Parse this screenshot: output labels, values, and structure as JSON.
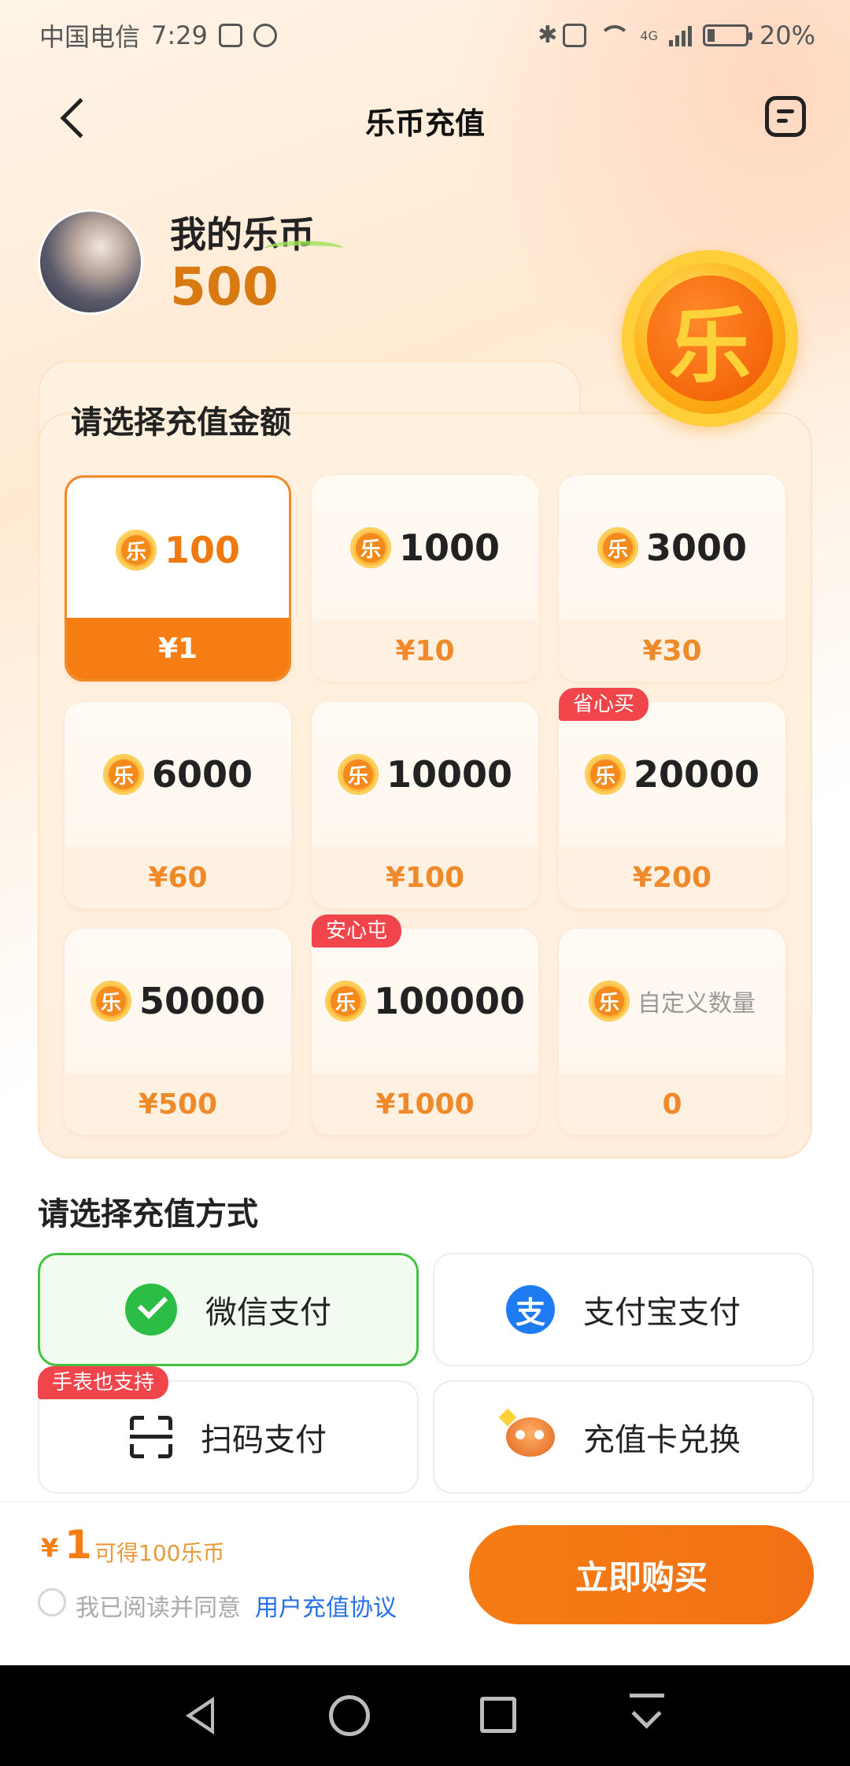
{
  "status_bar": {
    "carrier": "中国电信",
    "time": "7:29",
    "network": "4G",
    "battery": "20%",
    "battery_level": 0.2
  },
  "header": {
    "title": "乐币充值",
    "back_icon": "chevron-left-icon",
    "orders_icon": "order-list-icon"
  },
  "profile": {
    "label": "我的乐币",
    "balance": "500"
  },
  "amount_section": {
    "title": "请选择充值金额",
    "coin_glyph": "乐",
    "options": [
      {
        "coins": "100",
        "price": "¥1",
        "selected": true,
        "tag": ""
      },
      {
        "coins": "1000",
        "price": "¥10",
        "selected": false,
        "tag": ""
      },
      {
        "coins": "3000",
        "price": "¥30",
        "selected": false,
        "tag": ""
      },
      {
        "coins": "6000",
        "price": "¥60",
        "selected": false,
        "tag": ""
      },
      {
        "coins": "10000",
        "price": "¥100",
        "selected": false,
        "tag": ""
      },
      {
        "coins": "20000",
        "price": "¥200",
        "selected": false,
        "tag": "省心买"
      },
      {
        "coins": "50000",
        "price": "¥500",
        "selected": false,
        "tag": ""
      },
      {
        "coins": "100000",
        "price": "¥1000",
        "selected": false,
        "tag": "安心屯"
      },
      {
        "coins": "自定义数量",
        "price": "0",
        "selected": false,
        "tag": ""
      }
    ]
  },
  "payment_section": {
    "title": "请选择充值方式",
    "methods": [
      {
        "label": "微信支付",
        "icon": "wechat-pay-icon",
        "selected": true,
        "tag": ""
      },
      {
        "label": "支付宝支付",
        "icon": "alipay-icon",
        "icon_glyph": "支",
        "selected": false,
        "tag": ""
      },
      {
        "label": "扫码支付",
        "icon": "qr-scan-icon",
        "selected": false,
        "tag": "手表也支持"
      },
      {
        "label": "充值卡兑换",
        "icon": "recharge-card-icon",
        "selected": false,
        "tag": ""
      }
    ]
  },
  "checkout": {
    "currency": "¥",
    "amount": "1",
    "description": "可得100乐币",
    "agree_text": "我已阅读并同意",
    "agreement_link": "用户充值协议",
    "buy_label": "立即购买"
  },
  "colors": {
    "accent": "#f57d14",
    "coin_text": "#d87a12",
    "tag_red": "#f0454b",
    "wechat_green": "#2bbd46",
    "alipay_blue": "#1f7bf2",
    "link_blue": "#2870e8"
  }
}
